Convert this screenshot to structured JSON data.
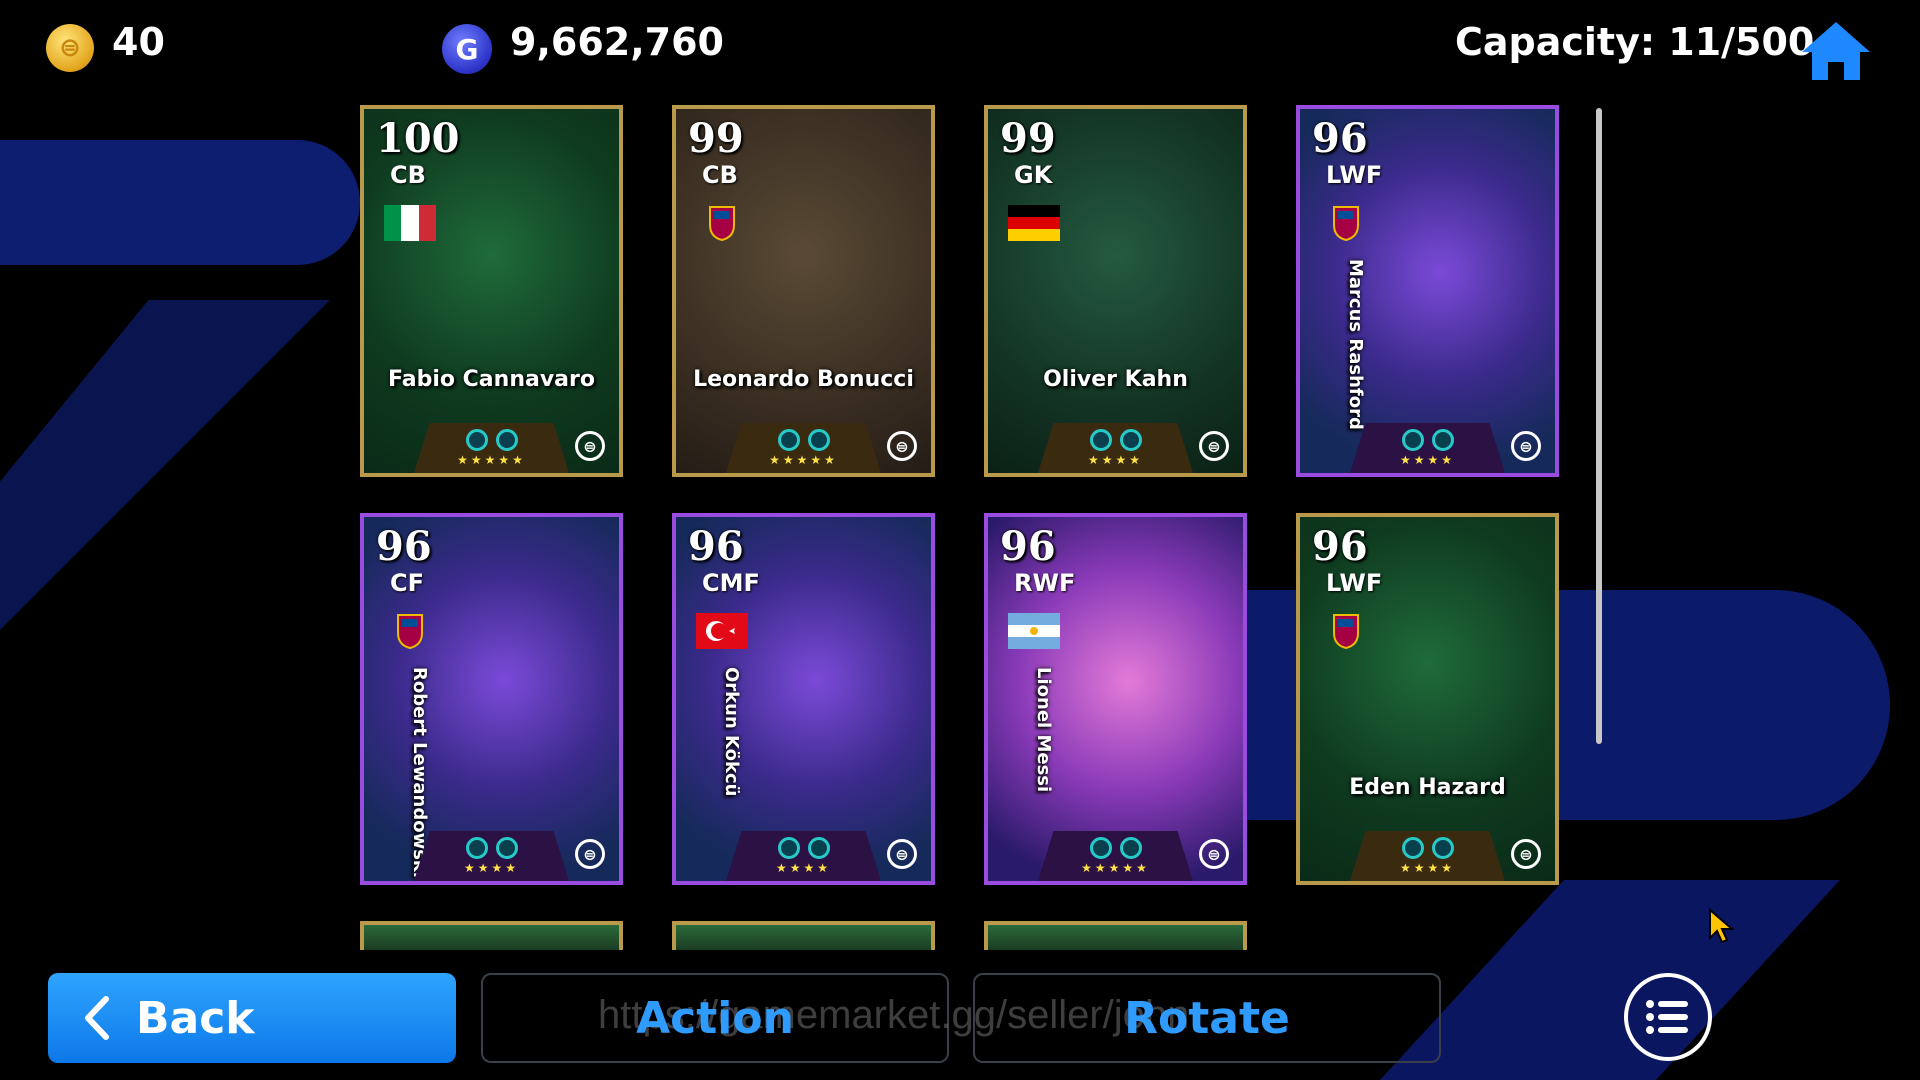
{
  "header": {
    "coins": "40",
    "gp": "9,662,760",
    "capacity": "Capacity: 11/500"
  },
  "icons": {
    "coin_glyph": "⊜",
    "gp_glyph": "G",
    "edition_glyph": "⊜"
  },
  "cards": [
    {
      "rating": "100",
      "position": "CB",
      "name": "Fabio Cannavaro",
      "badge": "italy-flag",
      "frame": "gold",
      "art": "green",
      "stars": "★★★★★"
    },
    {
      "rating": "99",
      "position": "CB",
      "name": "Leonardo Bonucci",
      "badge": "club-crest",
      "frame": "gold",
      "art": "sepia",
      "stars": "★★★★★"
    },
    {
      "rating": "99",
      "position": "GK",
      "name": "Oliver Kahn",
      "badge": "germany-flag",
      "frame": "gold",
      "art": "green-dark",
      "stars": "★★★★"
    },
    {
      "rating": "96",
      "position": "LWF",
      "name": "Marcus Rashford",
      "badge": "club-crest",
      "frame": "purple",
      "art": "neon",
      "stars": "★★★★"
    },
    {
      "rating": "96",
      "position": "CF",
      "name": "Robert Lewandowski",
      "badge": "club-crest",
      "frame": "purple",
      "art": "neon",
      "stars": "★★★★"
    },
    {
      "rating": "96",
      "position": "CMF",
      "name": "Orkun Kökcü",
      "badge": "turkey-flag",
      "frame": "purple",
      "art": "neon",
      "stars": "★★★★"
    },
    {
      "rating": "96",
      "position": "RWF",
      "name": "Lionel Messi",
      "badge": "argentina-flag",
      "frame": "purple",
      "art": "pink",
      "stars": "★★★★★"
    },
    {
      "rating": "96",
      "position": "LWF",
      "name": "Eden Hazard",
      "badge": "club-crest",
      "frame": "gold",
      "art": "green",
      "stars": "★★★★"
    }
  ],
  "footer": {
    "back_label": "Back",
    "action_label": "Action",
    "rotate_label": "Rotate",
    "watermark": "https://gamemarket.gg/seller/john"
  },
  "colors": {
    "accent": "#2f9bff",
    "gold_frame": "#b99a4a",
    "purple_frame": "#9a4be0"
  }
}
